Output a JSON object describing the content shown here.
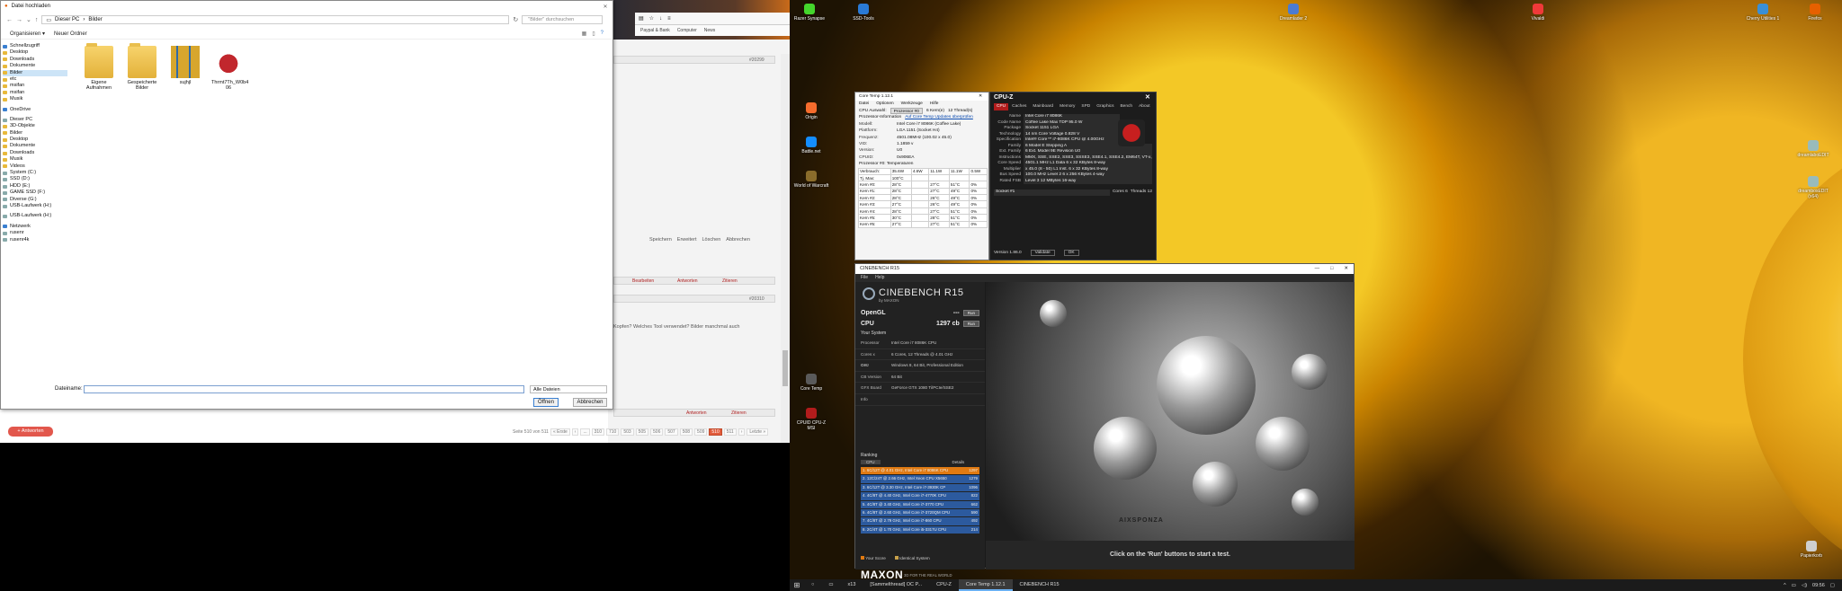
{
  "file_dialog": {
    "title": "Datei hochladen",
    "path": [
      "Dieser PC",
      "Bilder"
    ],
    "search_placeholder": "\"Bilder\" durchsuchen",
    "toolbar": {
      "organize": "Organisieren ▾",
      "new_folder": "Neuer Ordner"
    },
    "tree": [
      {
        "label": "Schnellzugriff",
        "type": "blue"
      },
      {
        "label": "Desktop",
        "type": "folder"
      },
      {
        "label": "Downloads",
        "type": "folder"
      },
      {
        "label": "Dokumente",
        "type": "folder"
      },
      {
        "label": "Bilder",
        "type": "folder",
        "selected": true
      },
      {
        "label": "etc",
        "type": "folder"
      },
      {
        "label": "msifan",
        "type": "folder"
      },
      {
        "label": "msifan",
        "type": "folder"
      },
      {
        "label": "Musik",
        "type": "folder"
      },
      {
        "gap": true
      },
      {
        "label": "OneDrive",
        "type": "blue"
      },
      {
        "gap": true
      },
      {
        "label": "Dieser PC",
        "type": "drv"
      },
      {
        "label": "3D-Objekte",
        "type": "folder"
      },
      {
        "label": "Bilder",
        "type": "folder"
      },
      {
        "label": "Desktop",
        "type": "folder"
      },
      {
        "label": "Dokumente",
        "type": "folder"
      },
      {
        "label": "Downloads",
        "type": "folder"
      },
      {
        "label": "Musik",
        "type": "folder"
      },
      {
        "label": "Videos",
        "type": "folder"
      },
      {
        "label": "System (C:)",
        "type": "drv"
      },
      {
        "label": "SSD (D:)",
        "type": "drv"
      },
      {
        "label": "HDD (E:)",
        "type": "drv"
      },
      {
        "label": "GAME SSD (F:)",
        "type": "drv"
      },
      {
        "label": "Diverse (G:)",
        "type": "drv"
      },
      {
        "label": "USB-Laufwerk (H:)",
        "type": "drv"
      },
      {
        "gap": true
      },
      {
        "label": "USB-Laufwerk (H:)",
        "type": "drv"
      },
      {
        "gap": true
      },
      {
        "label": "Netzwerk",
        "type": "blue"
      },
      {
        "label": "rusenr",
        "type": "drv"
      },
      {
        "label": "rusenr4k",
        "type": "drv"
      }
    ],
    "files": [
      {
        "name": "Eigene Aufnahmen",
        "kind": "folder"
      },
      {
        "name": "Gespeicherte Bilder",
        "kind": "folder"
      },
      {
        "name": "sujhjl",
        "kind": "zip"
      },
      {
        "name": "Thrmt7Th_W0b4 06",
        "kind": "bull"
      }
    ],
    "filename_label": "Dateiname:",
    "filetype": "Alle Dateien",
    "open_button": "Öffnen",
    "cancel_button": "Abbrechen"
  },
  "forum": {
    "post_numbers": [
      "#20299",
      "#20310"
    ],
    "actions": [
      "Bearbeiten",
      "Antworten",
      "Zitieren"
    ],
    "editor_buttons": [
      "Speichern",
      "Erweitert",
      "Löschen",
      "Abbrechen"
    ],
    "question_text": "Kopfen? Welches Tool verwendet? Bilder manchmal auch",
    "reply_button": "+ Antworten",
    "pager_label": "Seite 510 von 511",
    "pages": [
      "« Erste",
      "‹",
      "...",
      "310",
      "710",
      "503",
      "505",
      "506",
      "507",
      "508",
      "509",
      "510",
      "511",
      "›",
      "Letzte »"
    ],
    "current_page": "510",
    "bookmarks": [
      "Paypal & Bank",
      "Computer",
      "News"
    ]
  },
  "desktop_icons": [
    {
      "label": "Razer Synapse",
      "color": "#44d62c"
    },
    {
      "label": "SSD-Tools",
      "color": "#2a7ad6"
    },
    {
      "label": "Origin",
      "color": "#f56c2d"
    },
    {
      "label": "Battle.net",
      "color": "#148eff"
    },
    {
      "label": "World of Warcraft",
      "color": "#8a6c2b"
    },
    {
      "label": "Core Temp",
      "color": "#5a5a5a"
    },
    {
      "label": "CPUID CPU-Z MSI",
      "color": "#b21c1c"
    },
    {
      "label": "Dreamlader 2",
      "color": "#4b7bd1"
    },
    {
      "label": "Vivaldi",
      "color": "#ef3939"
    },
    {
      "label": "Cherry Utilities 1",
      "color": "#3a8fd6"
    },
    {
      "label": "Firefox",
      "color": "#e66000"
    },
    {
      "label": "dreamlaboEDIT",
      "color": "#9bb"
    },
    {
      "label": "dreamboxEDIT (x64)",
      "color": "#9bb"
    },
    {
      "label": "Papierkorb",
      "color": "#cfcfcf"
    }
  ],
  "core_temp": {
    "title": "Core Temp 1.12.1",
    "menu": [
      "Datei",
      "Optionen",
      "Werkzeuge",
      "Hilfe"
    ],
    "select_label": "CPU Auswahl:",
    "select_value": "Prozessor #0",
    "cores": "6 Kern(e)",
    "threads": "12 Thread(s)",
    "info_label": "Prozessor-Information",
    "info_link": "Auf Core Temp Updates überprüfen",
    "rows": [
      {
        "k": "Modell:",
        "v": "Intel Core i7 8086K (Coffee Lake)"
      },
      {
        "k": "Plattform:",
        "v": "LGA 1151 (Socket H4)"
      },
      {
        "k": "Frequenz:",
        "v": "4501.08MHz (100.02 x 45.0)"
      },
      {
        "k": "VID:",
        "v": "1.1859 v"
      },
      {
        "k": "Version:",
        "v": "U0"
      },
      {
        "k": "CPUID:",
        "v": "0x906EA"
      }
    ],
    "lithography": "14 nm",
    "tdp": "95.0 Watt",
    "temps_label": "Prozessor #0: Temperaturen",
    "temps_header": [
      "",
      "",
      "",
      "Min.",
      "Max.",
      "Last"
    ],
    "temps": [
      [
        "Verbrauch:",
        "35.6W",
        "4.6W",
        "11.1W",
        "11.1W",
        "0.5W"
      ],
      [
        "Tj. Max:",
        "100°C",
        "",
        "",
        "",
        ""
      ],
      [
        "Kern #0:",
        "28°C",
        "",
        "27°C",
        "51°C",
        "0%"
      ],
      [
        "Kern #1:",
        "28°C",
        "",
        "27°C",
        "49°C",
        "0%"
      ],
      [
        "Kern #2:",
        "28°C",
        "",
        "26°C",
        "49°C",
        "0%"
      ],
      [
        "Kern #3:",
        "27°C",
        "",
        "26°C",
        "49°C",
        "0%"
      ],
      [
        "Kern #4:",
        "28°C",
        "",
        "27°C",
        "51°C",
        "0%"
      ],
      [
        "Kern #5:",
        "30°C",
        "",
        "28°C",
        "51°C",
        "0%"
      ],
      [
        "Kern #5:",
        "27°C",
        "",
        "27°C",
        "51°C",
        "0%"
      ]
    ]
  },
  "cpuz": {
    "title": "CPU-Z",
    "tabs": [
      "CPU",
      "Caches",
      "Mainboard",
      "Memory",
      "SPD",
      "Graphics",
      "Bench",
      "About"
    ],
    "rows": [
      {
        "k": "Name",
        "v": "Intel Core i7 8086K"
      },
      {
        "k": "Code Name",
        "v": "Coffee Lake     Max TDP 95.0 W"
      },
      {
        "k": "Package",
        "v": "Socket 1151 LGA"
      },
      {
        "k": "Technology",
        "v": "14 nm     Core Voltage 0.828 V"
      },
      {
        "k": "Specification",
        "v": "Intel® Core™ i7-8086K CPU @ 4.00GHz"
      },
      {
        "k": "Family",
        "v": "6     Model E     Stepping A"
      },
      {
        "k": "Ext. Family",
        "v": "6     Ext. Model 9E     Revision U0"
      },
      {
        "k": "Instructions",
        "v": "MMX, SSE, SSE2, SSE3, SSSE3, SSE4.1, SSE4.2, EM64T, VT-x, AES, AVX, AVX2, FMA3, TSX"
      },
      {
        "k": "Core Speed",
        "v": "4501.1 MHz     L1 Data 6 x 32 KBytes 8-way"
      },
      {
        "k": "Multiplier",
        "v": "x 45.0 (8 - 50)     L1 Inst. 6 x 32 KBytes 8-way"
      },
      {
        "k": "Bus Speed",
        "v": "100.0 MHz     Level 2 6 x 256 KBytes 4-way"
      },
      {
        "k": "Rated FSB",
        "v": "     Level 3 12 MBytes 16-way"
      }
    ],
    "selection": "Socket #1",
    "cores": "Cores 6",
    "threads": "Threads 12",
    "version": "Version 1.86.0",
    "validate": "Validate",
    "ok": "OK"
  },
  "cinebench": {
    "title": "CINEBENCH R15",
    "menu": [
      "File",
      "Help"
    ],
    "brand": "CINEBENCH R15",
    "by": "by MAXON",
    "opengl_label": "OpenGL",
    "opengl_value": "---",
    "cpu_label": "CPU",
    "cpu_value": "1297 cb",
    "run": "Run",
    "system_label": "Your System",
    "system": [
      {
        "k": "Processor",
        "v": "Intel Core i7 8086K CPU"
      },
      {
        "k": "Cores x GHz",
        "v": "6 Cores, 12 Threads @ 4.01 GHz"
      },
      {
        "k": "OS",
        "v": "Windows 8, 64 Bit, Professional Edition"
      },
      {
        "k": "CB Version",
        "v": "64 Bit"
      },
      {
        "k": "GFX Board",
        "v": "GeForce GTX 1080 Ti/PCIe/SSE2"
      },
      {
        "k": "Info",
        "v": ""
      }
    ],
    "ranking_label": "Ranking",
    "ranking_select": "CPU",
    "details": "Details",
    "ranking": [
      {
        "t": "1. 6C/12T @ 4.01 GHz, Intel Core i7 8086K CPU",
        "v": "1297",
        "mine": true
      },
      {
        "t": "2. 12C/24T @ 2.66 GHz, Intel Xeon CPU X5650",
        "v": "1279"
      },
      {
        "t": "3. 6C/12T @ 3.30 GHz, Intel Core i7-3930K CP",
        "v": "1096"
      },
      {
        "t": "4. 4C/8T @ 4.40 GHz, Intel Core i7-4770K CPU",
        "v": "822"
      },
      {
        "t": "5. 4C/8T @ 3.40 GHz, Intel Core i7-3770 CPU",
        "v": "662"
      },
      {
        "t": "6. 4C/8T @ 2.60 GHz, Intel Core i7-3720QM CPU",
        "v": "590"
      },
      {
        "t": "7. 4C/8T @ 2.79 GHz, Intel Core i7-860 CPU",
        "v": "492"
      },
      {
        "t": "8. 2C/4T @ 1.70 GHz, Intel Core i5-3317U CPU",
        "v": "214"
      }
    ],
    "legend": [
      "Your Score",
      "Identical System"
    ],
    "maxon": "MAXON",
    "maxon_sub": "3D FOR THE REAL WORLD",
    "status": "Click on the 'Run' buttons to start a test.",
    "watermark": "AIXSPONZA"
  },
  "taskbar": {
    "items": [
      "x13",
      "[Sammelthread] OC P...",
      "CPU-Z",
      "Core Temp 1.12.1",
      "CINEBENCH R15"
    ],
    "active": "Core Temp 1.12.1",
    "clock": "09:56"
  }
}
